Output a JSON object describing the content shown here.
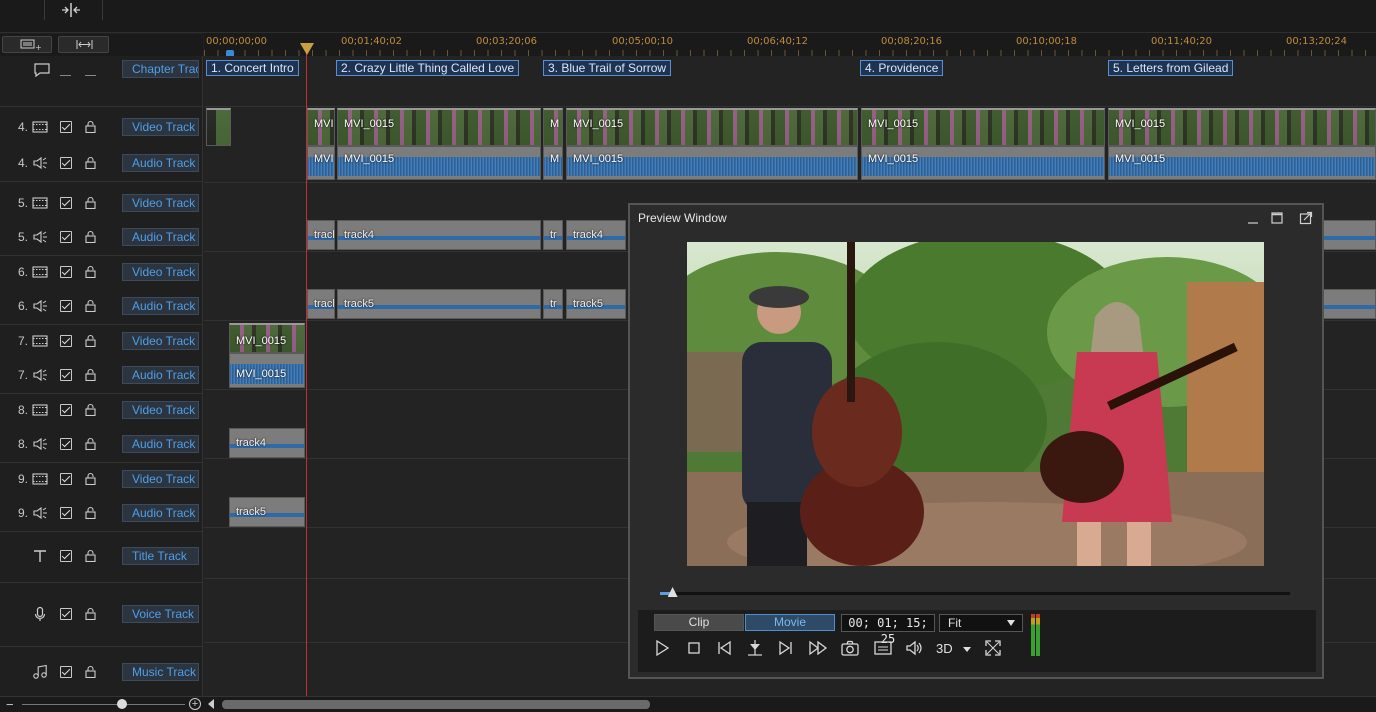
{
  "timeline": {
    "ruler_labels": [
      "00;00;00;00",
      "00;01;40;02",
      "00;03;20;06",
      "00;05;00;10",
      "00;06;40;12",
      "00;08;20;16",
      "00;10;00;18",
      "00;11;40;20",
      "00;13;20;24"
    ],
    "chapter_track_label": "Chapter Track",
    "chapters": [
      "1. Concert Intro",
      "2. Crazy Little Thing Called Love",
      "3. Blue Trail of Sorrow",
      "4. Providence",
      "5. Letters from Gilead"
    ],
    "tracks": [
      {
        "num": "4.",
        "label": "Video Track",
        "kind": "video"
      },
      {
        "num": "4.",
        "label": "Audio Track",
        "kind": "audio"
      },
      {
        "num": "5.",
        "label": "Video Track",
        "kind": "video"
      },
      {
        "num": "5.",
        "label": "Audio Track",
        "kind": "audio"
      },
      {
        "num": "6.",
        "label": "Video Track",
        "kind": "video"
      },
      {
        "num": "6.",
        "label": "Audio Track",
        "kind": "audio"
      },
      {
        "num": "7.",
        "label": "Video Track",
        "kind": "video"
      },
      {
        "num": "7.",
        "label": "Audio Track",
        "kind": "audio"
      },
      {
        "num": "8.",
        "label": "Video Track",
        "kind": "video"
      },
      {
        "num": "8.",
        "label": "Audio Track",
        "kind": "audio"
      },
      {
        "num": "9.",
        "label": "Video Track",
        "kind": "video"
      },
      {
        "num": "9.",
        "label": "Audio Track",
        "kind": "audio"
      }
    ],
    "title_track": "Title Track",
    "voice_track": "Voice Track",
    "music_track": "Music Track",
    "clip_names": {
      "mvi_short": "MVI",
      "mvi_full": "MVI_0015",
      "m_short": "M",
      "track4": "track4",
      "track5": "track5",
      "trac": "track",
      "tr": "tr"
    }
  },
  "preview": {
    "title": "Preview Window",
    "clip_label": "Clip",
    "movie_label": "Movie",
    "timecode": "00; 01; 15; 25",
    "fit_value": "Fit",
    "label_3d": "3D",
    "scrub_position": 0.02
  },
  "colors": {
    "accent_blue": "#4f9fe8",
    "playhead_red": "#c03030",
    "ruler_orange": "#c08a3a"
  }
}
